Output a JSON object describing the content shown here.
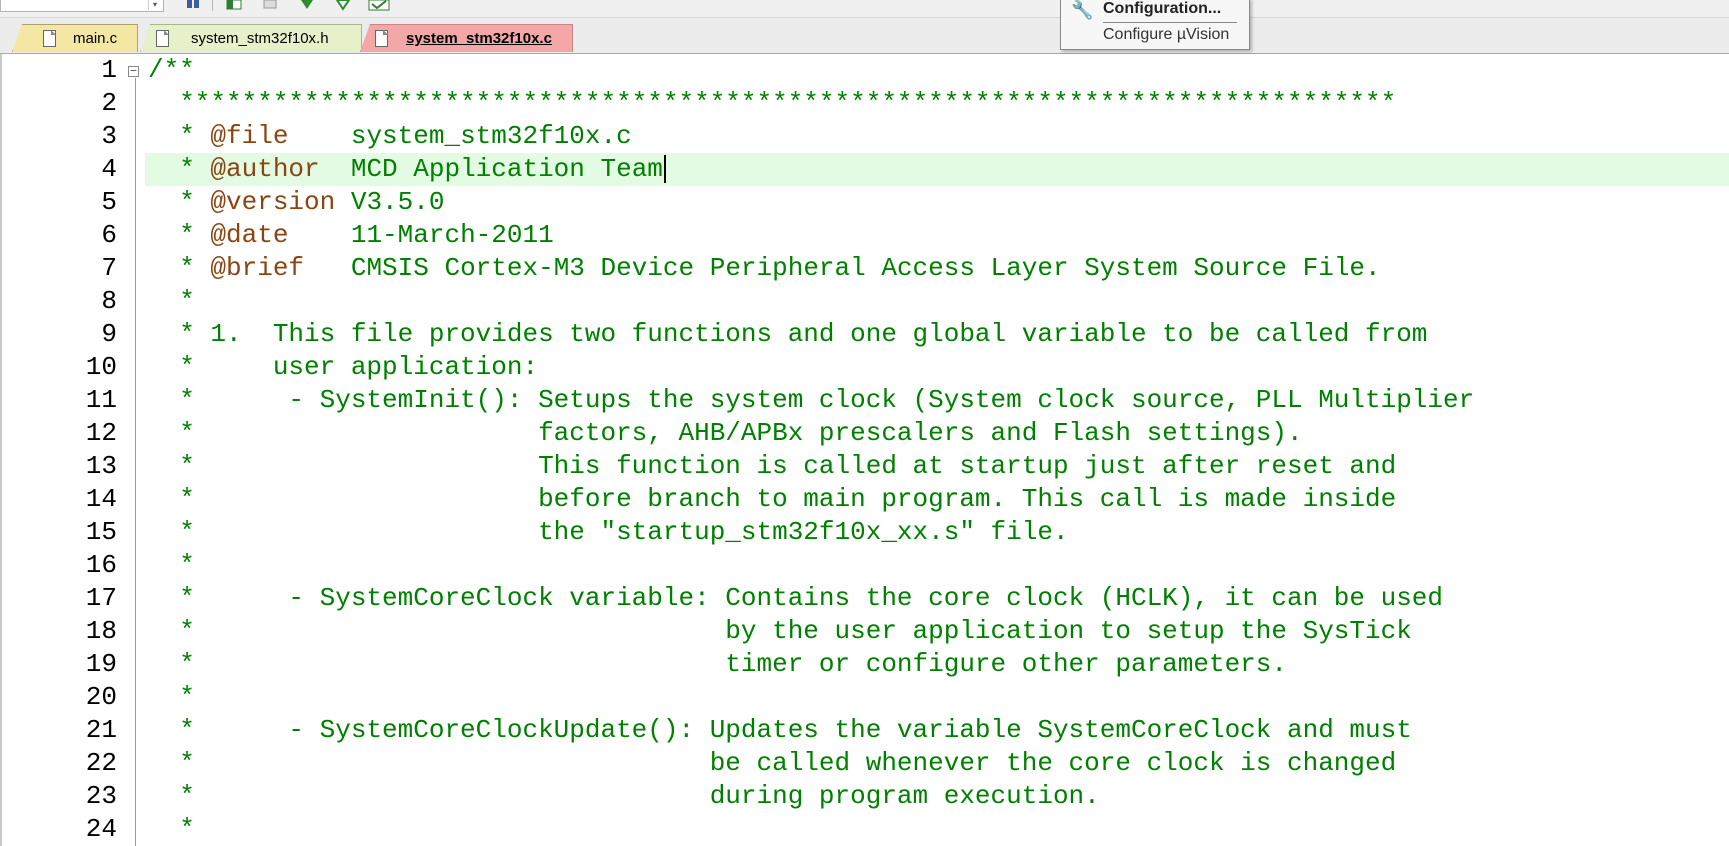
{
  "tabs": [
    {
      "label": "main.c"
    },
    {
      "label": "system_stm32f10x.h"
    },
    {
      "label": "system_stm32f10x.c",
      "active": true
    }
  ],
  "tooltip": {
    "title": "Configuration...",
    "description": "Configure µVision"
  },
  "editor": {
    "current_line": 4,
    "lines": [
      {
        "num": "1",
        "text": "/**"
      },
      {
        "num": "2",
        "text": "  ******************************************************************************"
      },
      {
        "num": "3",
        "tag": "@file",
        "pre": "  * ",
        "text": "    system_stm32f10x.c"
      },
      {
        "num": "4",
        "tag": "@author",
        "pre": "  * ",
        "text": "  MCD Application Team"
      },
      {
        "num": "5",
        "tag": "@version",
        "pre": "  * ",
        "text": " V3.5.0"
      },
      {
        "num": "6",
        "tag": "@date",
        "pre": "  * ",
        "text": "    11-March-2011"
      },
      {
        "num": "7",
        "tag": "@brief",
        "pre": "  * ",
        "text": "   CMSIS Cortex-M3 Device Peripheral Access Layer System Source File."
      },
      {
        "num": "8",
        "text": "  *"
      },
      {
        "num": "9",
        "text": "  * 1.  This file provides two functions and one global variable to be called from"
      },
      {
        "num": "10",
        "text": "  *     user application:"
      },
      {
        "num": "11",
        "text": "  *      - SystemInit(): Setups the system clock (System clock source, PLL Multiplier"
      },
      {
        "num": "12",
        "text": "  *                      factors, AHB/APBx prescalers and Flash settings)."
      },
      {
        "num": "13",
        "text": "  *                      This function is called at startup just after reset and"
      },
      {
        "num": "14",
        "text": "  *                      before branch to main program. This call is made inside"
      },
      {
        "num": "15",
        "text": "  *                      the \"startup_stm32f10x_xx.s\" file."
      },
      {
        "num": "16",
        "text": "  *"
      },
      {
        "num": "17",
        "text": "  *      - SystemCoreClock variable: Contains the core clock (HCLK), it can be used"
      },
      {
        "num": "18",
        "text": "  *                                  by the user application to setup the SysTick"
      },
      {
        "num": "19",
        "text": "  *                                  timer or configure other parameters."
      },
      {
        "num": "20",
        "text": "  *"
      },
      {
        "num": "21",
        "text": "  *      - SystemCoreClockUpdate(): Updates the variable SystemCoreClock and must"
      },
      {
        "num": "22",
        "text": "  *                                 be called whenever the core clock is changed"
      },
      {
        "num": "23",
        "text": "  *                                 during program execution."
      },
      {
        "num": "24",
        "text": "  *"
      }
    ]
  },
  "colors": {
    "comment": "#008000",
    "doc_tag": "#8b4513",
    "current_line_bg": "#e3fbe3",
    "active_tab": "#f4a7a7"
  },
  "icons": [
    "file-icon",
    "header-file-icon",
    "wrench-icon",
    "fold-minus-icon"
  ]
}
